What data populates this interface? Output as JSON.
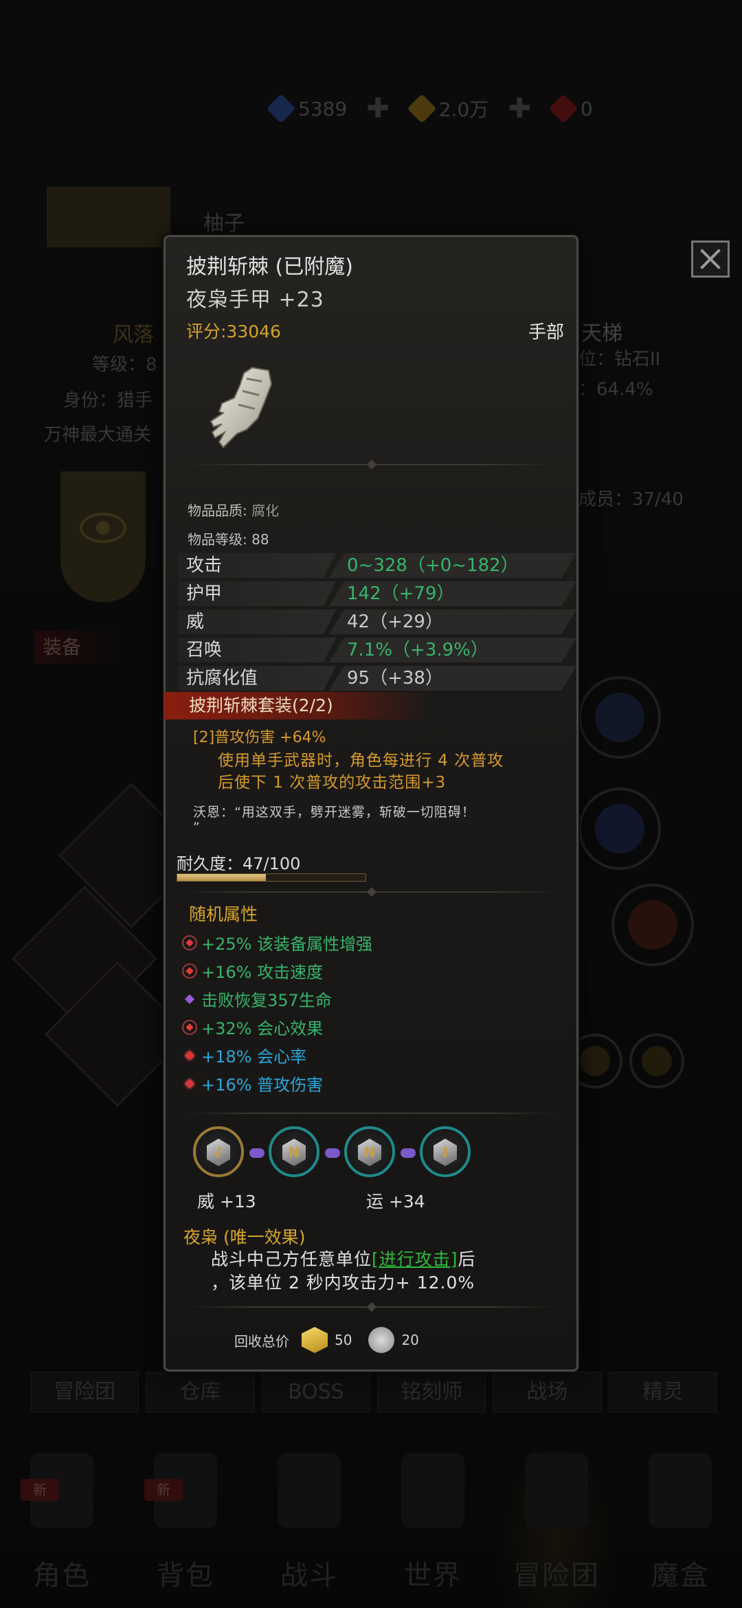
{
  "resources": [
    {
      "value": "5389",
      "color": "#2a4a8a",
      "icon": "blue-crystal-icon"
    },
    {
      "value": "2.0万",
      "color": "#8a6a1a",
      "icon": "gold-crystal-icon"
    },
    {
      "value": "0",
      "color": "#7a1a1a",
      "icon": "red-crystal-icon"
    }
  ],
  "background": {
    "player_name": "柚子",
    "title_left": "风落",
    "level_label": "等级：8",
    "identity_label": "身份：猎手",
    "record_label": "万神最大通关",
    "ladder_label": "天梯",
    "rank_label": "位：钻石II",
    "rate_label": "：64.4%",
    "members_label": "成员：37/40",
    "equip_tab": "装备"
  },
  "tooltip": {
    "name": "披荆斩棘 (已附魔)",
    "subtitle": "夜枭手甲 +23",
    "score": "评分:33046",
    "slot": "手部",
    "quality_label": "物品品质: ",
    "quality_value": "腐化",
    "level_label": "物品等级: 88",
    "stats": [
      {
        "name": "攻击",
        "value": "0~328（+0~182）",
        "tone": "green"
      },
      {
        "name": "护甲",
        "value": "142（+79）",
        "tone": "green"
      },
      {
        "name": "威",
        "value": "42（+29）",
        "tone": "white"
      },
      {
        "name": "召唤",
        "value": "7.1%（+3.9%）",
        "tone": "green"
      },
      {
        "name": "抗腐化值",
        "value": "95（+38）",
        "tone": "white"
      }
    ],
    "set_title": "披荆斩棘套装(2/2)",
    "set_bonus": "[2]普攻伤害 +64%",
    "set_desc_1": "使用单手武器时，角色每进行 4 次普攻",
    "set_desc_2": "后使下 1 次普攻的攻击范围+3",
    "quote_1": "沃恩：“用这双手，劈开迷雾，斩破一切阻碍！",
    "quote_2": "”",
    "durability_label": "耐久度：47/100",
    "durability": 0.47,
    "random_title": "随机属性",
    "random_attrs": [
      {
        "text": "+25% 该装备属性增强",
        "color": "#37b46a",
        "badge": "ring"
      },
      {
        "text": "+16% 攻击速度",
        "color": "#37b46a",
        "badge": "ring"
      },
      {
        "text": "击败恢复357生命",
        "color": "#37b46a",
        "badge": "purple"
      },
      {
        "text": "+32% 会心效果",
        "color": "#37b46a",
        "badge": "ring"
      },
      {
        "text": "+18% 会心率",
        "color": "#2aa7d9",
        "badge": "red"
      },
      {
        "text": "+16% 普攻伤害",
        "color": "#2aa7d9",
        "badge": "red"
      }
    ],
    "gem_bonus_1": "威 +13",
    "gem_bonus_2": "运 +34",
    "effect_title": "夜枭 (唯一效果)",
    "effect_line1_pre": "战斗中己方任意单位",
    "effect_link": "[进行攻击]",
    "effect_line1_post": "后",
    "effect_line2": "，该单位 2 秒内攻击力+ 12.0%",
    "recycle_label": "回收总价",
    "recycle_gold": "50",
    "recycle_shard": "20"
  },
  "tabs": [
    "冒险团",
    "仓库",
    "BOSS",
    "铭刻师",
    "战场",
    "精灵"
  ],
  "nav": [
    {
      "label": "角色",
      "badge": "新"
    },
    {
      "label": "背包",
      "badge": "新"
    },
    {
      "label": "战斗",
      "badge": ""
    },
    {
      "label": "世界",
      "badge": ""
    },
    {
      "label": "冒险团",
      "badge": ""
    },
    {
      "label": "魔盒",
      "badge": ""
    }
  ]
}
